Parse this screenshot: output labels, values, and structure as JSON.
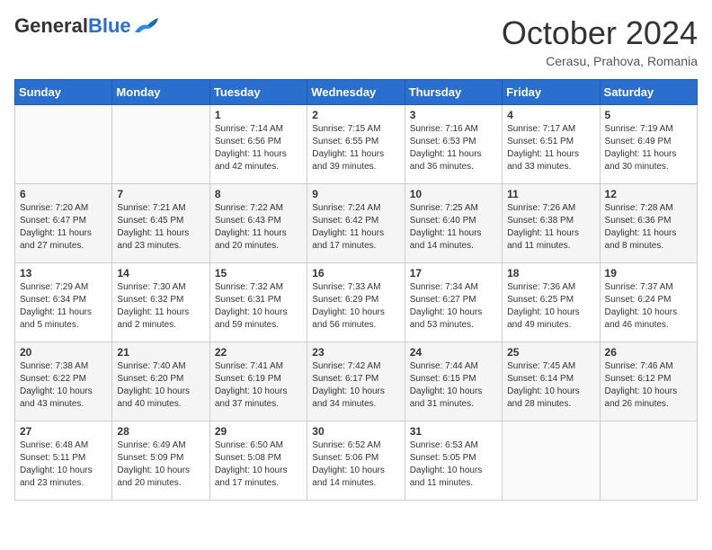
{
  "logo": {
    "general": "General",
    "blue": "Blue"
  },
  "header": {
    "month": "October 2024",
    "location": "Cerasu, Prahova, Romania"
  },
  "weekdays": [
    "Sunday",
    "Monday",
    "Tuesday",
    "Wednesday",
    "Thursday",
    "Friday",
    "Saturday"
  ],
  "weeks": [
    [
      {
        "day": "",
        "info": ""
      },
      {
        "day": "",
        "info": ""
      },
      {
        "day": "1",
        "info": "Sunrise: 7:14 AM\nSunset: 6:56 PM\nDaylight: 11 hours and 42 minutes."
      },
      {
        "day": "2",
        "info": "Sunrise: 7:15 AM\nSunset: 6:55 PM\nDaylight: 11 hours and 39 minutes."
      },
      {
        "day": "3",
        "info": "Sunrise: 7:16 AM\nSunset: 6:53 PM\nDaylight: 11 hours and 36 minutes."
      },
      {
        "day": "4",
        "info": "Sunrise: 7:17 AM\nSunset: 6:51 PM\nDaylight: 11 hours and 33 minutes."
      },
      {
        "day": "5",
        "info": "Sunrise: 7:19 AM\nSunset: 6:49 PM\nDaylight: 11 hours and 30 minutes."
      }
    ],
    [
      {
        "day": "6",
        "info": "Sunrise: 7:20 AM\nSunset: 6:47 PM\nDaylight: 11 hours and 27 minutes."
      },
      {
        "day": "7",
        "info": "Sunrise: 7:21 AM\nSunset: 6:45 PM\nDaylight: 11 hours and 23 minutes."
      },
      {
        "day": "8",
        "info": "Sunrise: 7:22 AM\nSunset: 6:43 PM\nDaylight: 11 hours and 20 minutes."
      },
      {
        "day": "9",
        "info": "Sunrise: 7:24 AM\nSunset: 6:42 PM\nDaylight: 11 hours and 17 minutes."
      },
      {
        "day": "10",
        "info": "Sunrise: 7:25 AM\nSunset: 6:40 PM\nDaylight: 11 hours and 14 minutes."
      },
      {
        "day": "11",
        "info": "Sunrise: 7:26 AM\nSunset: 6:38 PM\nDaylight: 11 hours and 11 minutes."
      },
      {
        "day": "12",
        "info": "Sunrise: 7:28 AM\nSunset: 6:36 PM\nDaylight: 11 hours and 8 minutes."
      }
    ],
    [
      {
        "day": "13",
        "info": "Sunrise: 7:29 AM\nSunset: 6:34 PM\nDaylight: 11 hours and 5 minutes."
      },
      {
        "day": "14",
        "info": "Sunrise: 7:30 AM\nSunset: 6:32 PM\nDaylight: 11 hours and 2 minutes."
      },
      {
        "day": "15",
        "info": "Sunrise: 7:32 AM\nSunset: 6:31 PM\nDaylight: 10 hours and 59 minutes."
      },
      {
        "day": "16",
        "info": "Sunrise: 7:33 AM\nSunset: 6:29 PM\nDaylight: 10 hours and 56 minutes."
      },
      {
        "day": "17",
        "info": "Sunrise: 7:34 AM\nSunset: 6:27 PM\nDaylight: 10 hours and 53 minutes."
      },
      {
        "day": "18",
        "info": "Sunrise: 7:36 AM\nSunset: 6:25 PM\nDaylight: 10 hours and 49 minutes."
      },
      {
        "day": "19",
        "info": "Sunrise: 7:37 AM\nSunset: 6:24 PM\nDaylight: 10 hours and 46 minutes."
      }
    ],
    [
      {
        "day": "20",
        "info": "Sunrise: 7:38 AM\nSunset: 6:22 PM\nDaylight: 10 hours and 43 minutes."
      },
      {
        "day": "21",
        "info": "Sunrise: 7:40 AM\nSunset: 6:20 PM\nDaylight: 10 hours and 40 minutes."
      },
      {
        "day": "22",
        "info": "Sunrise: 7:41 AM\nSunset: 6:19 PM\nDaylight: 10 hours and 37 minutes."
      },
      {
        "day": "23",
        "info": "Sunrise: 7:42 AM\nSunset: 6:17 PM\nDaylight: 10 hours and 34 minutes."
      },
      {
        "day": "24",
        "info": "Sunrise: 7:44 AM\nSunset: 6:15 PM\nDaylight: 10 hours and 31 minutes."
      },
      {
        "day": "25",
        "info": "Sunrise: 7:45 AM\nSunset: 6:14 PM\nDaylight: 10 hours and 28 minutes."
      },
      {
        "day": "26",
        "info": "Sunrise: 7:46 AM\nSunset: 6:12 PM\nDaylight: 10 hours and 26 minutes."
      }
    ],
    [
      {
        "day": "27",
        "info": "Sunrise: 6:48 AM\nSunset: 5:11 PM\nDaylight: 10 hours and 23 minutes."
      },
      {
        "day": "28",
        "info": "Sunrise: 6:49 AM\nSunset: 5:09 PM\nDaylight: 10 hours and 20 minutes."
      },
      {
        "day": "29",
        "info": "Sunrise: 6:50 AM\nSunset: 5:08 PM\nDaylight: 10 hours and 17 minutes."
      },
      {
        "day": "30",
        "info": "Sunrise: 6:52 AM\nSunset: 5:06 PM\nDaylight: 10 hours and 14 minutes."
      },
      {
        "day": "31",
        "info": "Sunrise: 6:53 AM\nSunset: 5:05 PM\nDaylight: 10 hours and 11 minutes."
      },
      {
        "day": "",
        "info": ""
      },
      {
        "day": "",
        "info": ""
      }
    ]
  ]
}
